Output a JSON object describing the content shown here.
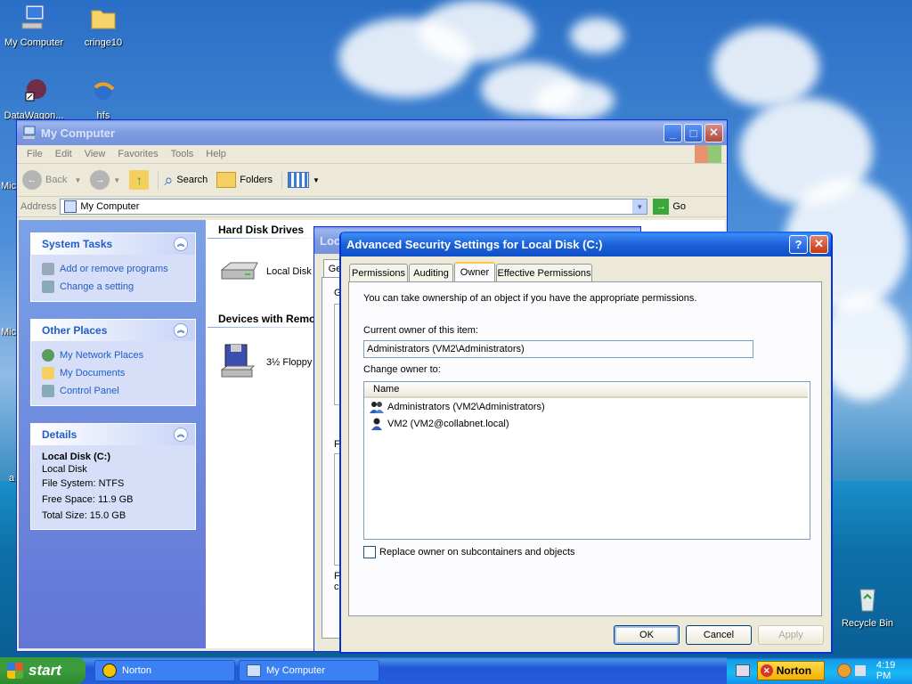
{
  "desktop": {
    "icons": [
      {
        "label": "My Computer"
      },
      {
        "label": "cringe10"
      },
      {
        "label": "DataWagon..."
      },
      {
        "label": "hfs"
      },
      {
        "label": "Recycle Bin"
      }
    ],
    "edge_labels": [
      "Mic",
      "Mic",
      "a"
    ]
  },
  "explorer": {
    "title": "My Computer",
    "menu": [
      "File",
      "Edit",
      "View",
      "Favorites",
      "Tools",
      "Help"
    ],
    "toolbar": {
      "back": "Back",
      "search": "Search",
      "folders": "Folders"
    },
    "address": {
      "label": "Address",
      "value": "My Computer",
      "go": "Go"
    },
    "system_tasks": {
      "title": "System Tasks",
      "items": [
        "Add or remove programs",
        "Change a setting"
      ]
    },
    "other_places": {
      "title": "Other Places",
      "items": [
        "My Network Places",
        "My Documents",
        "Control Panel"
      ]
    },
    "details": {
      "title": "Details",
      "name": "Local Disk (C:)",
      "type": "Local Disk",
      "fs": "File System: NTFS",
      "free": "Free Space: 11.9 GB",
      "total": "Total Size: 15.0 GB"
    },
    "hard_disk_header": "Hard Disk Drives",
    "local_disk_label": "Local Disk (",
    "removable_header": "Devices with Remo",
    "floppy_label": "3½ Floppy"
  },
  "props_window": {
    "title_fragment": "Loc",
    "tab_fragment": "Ge",
    "letters": [
      "G",
      "F",
      "F",
      "c"
    ]
  },
  "dialog": {
    "title": "Advanced Security Settings for Local Disk (C:)",
    "tabs": [
      "Permissions",
      "Auditing",
      "Owner",
      "Effective Permissions"
    ],
    "active_tab": "Owner",
    "info": "You can take ownership of an object if you have the appropriate permissions.",
    "current_owner_label": "Current owner of this item:",
    "current_owner_value": "Administrators (VM2\\Administrators)",
    "change_owner_label": "Change owner to:",
    "list_header": "Name",
    "owners": [
      "Administrators (VM2\\Administrators)",
      "VM2 (VM2@collabnet.local)"
    ],
    "replace_label": "Replace owner on subcontainers and objects",
    "buttons": {
      "ok": "OK",
      "cancel": "Cancel",
      "apply": "Apply"
    }
  },
  "taskbar": {
    "start": "start",
    "tasks": [
      "Norton",
      "My Computer"
    ],
    "tray_norton": "Norton",
    "clock": "4:19 PM"
  }
}
